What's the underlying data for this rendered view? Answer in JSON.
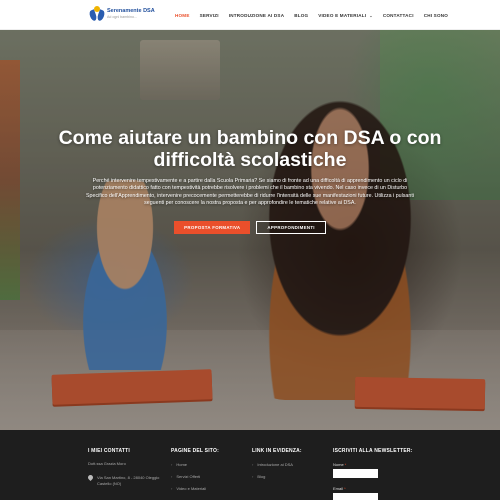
{
  "header": {
    "logo": {
      "title": "Serenamente DSA",
      "tagline": "Ad ogni bambino..."
    },
    "nav": [
      {
        "label": "HOME",
        "active": true
      },
      {
        "label": "SERVIZI"
      },
      {
        "label": "INTRODUZIONE AI DSA"
      },
      {
        "label": "BLOG"
      },
      {
        "label": "VIDEO E MATERIALI",
        "has_dropdown": true
      },
      {
        "label": "CONTATTACI"
      },
      {
        "label": "CHI SONO"
      }
    ]
  },
  "hero": {
    "title": "Come aiutare un bambino con DSA o con difficoltà scolastiche",
    "text": "Perché intervenire tempestivamente e a partire dalla Scuola Primaria? Se siamo di fronte ad una difficoltà di apprendimento un ciclo di potenziamento didattico fatto con tempestività potrebbe risolvere i problemi che il bambino sta vivendo. Nel caso invece di un Disturbo Specifico dell'Apprendimento, intervenire precocemente permetterebbe di ridurre l'intensità delle sue manifestazioni future. Utilizza i pulsanti seguenti per conoscere la nostra proposta e per approfondire le tematiche relative ai DSA.",
    "buttons": {
      "primary": "PROPOSTA FORMATIVA",
      "secondary": "APPROFONDIMENTI"
    }
  },
  "footer": {
    "contacts": {
      "heading": "I MIEI CONTATTI",
      "name": "Dott.ssa Grazia Moro",
      "address": [
        "Via San Martino, 8 - 28040 Oleggio",
        "Castello (NO)"
      ]
    },
    "pages": {
      "heading": "PAGINE DEL SITO:",
      "items": [
        "Home",
        "Servizi Offerti",
        "Video e Materiali"
      ]
    },
    "links": {
      "heading": "LINK IN EVIDENZA:",
      "items": [
        "Introduzione ai DSA",
        "Blog"
      ]
    },
    "newsletter": {
      "heading": "ISCRIVITI ALLA NEWSLETTER:",
      "name_label": "Nome",
      "email_label": "Email",
      "required_mark": "*"
    }
  },
  "colors": {
    "accent": "#ea4f2b",
    "footer_bg": "#1e1e1e",
    "logo_blue": "#1f4e9c"
  }
}
